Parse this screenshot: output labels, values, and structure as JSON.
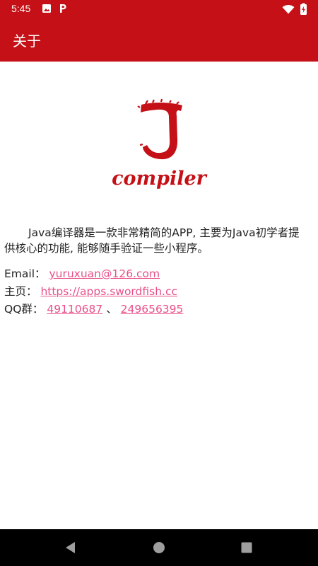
{
  "status_bar": {
    "time": "5:45",
    "icons": [
      "image-icon",
      "p-app-icon",
      "wifi-icon",
      "battery-charging-icon"
    ]
  },
  "app_bar": {
    "title": "关于"
  },
  "logo": {
    "text": "compiler",
    "color": "#c41016"
  },
  "content": {
    "intro": "Java编译器是一款非常精简的APP, 主要为Java初学者提供核心的功能, 能够随手验证一些小程序。",
    "email_label": "Email：",
    "email_value": "yuruxuan@126.com",
    "homepage_label": "主页：",
    "homepage_value": "https://apps.swordfish.cc",
    "qq_label": "QQ群：",
    "qq_group_1": "49110687",
    "qq_separator": "、",
    "qq_group_2": "249656395"
  },
  "colors": {
    "primary": "#c41016",
    "link": "#e8508a"
  },
  "nav_bar": {
    "icons": [
      "back-icon",
      "home-icon",
      "recents-icon"
    ]
  }
}
